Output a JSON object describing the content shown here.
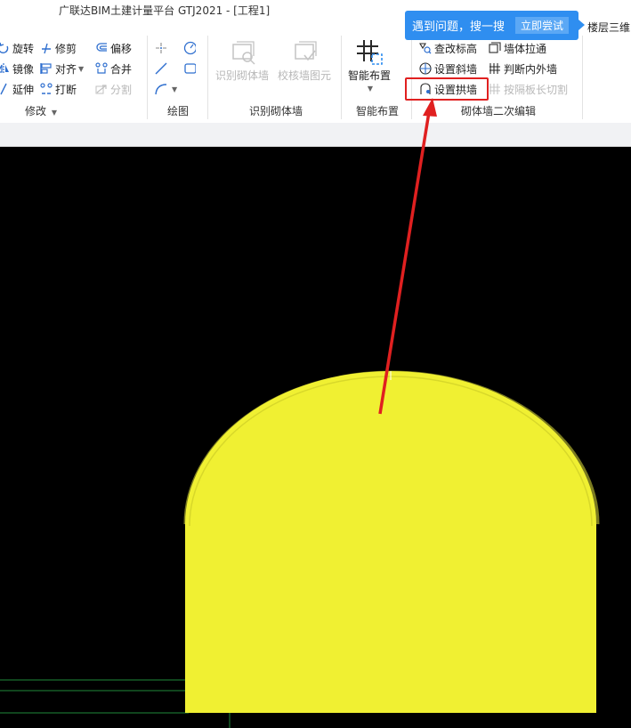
{
  "title": "广联达BIM土建计量平台 GTJ2021 - [工程1]",
  "tooltip": {
    "text": "遇到问题，搜一搜",
    "button": "立即尝试"
  },
  "side_text": "楼层三维",
  "modify": {
    "rotate": "旋转",
    "trim": "修剪",
    "offset": "偏移",
    "mirror": "镜像",
    "align": "对齐",
    "merge": "合并",
    "extend": "延伸",
    "break": "打断",
    "split": "分割",
    "group_label": "修改"
  },
  "draw": {
    "group_label": "绘图"
  },
  "recognize": {
    "identify_wall": "识别砌体墙",
    "check_wall": "校核墙图元",
    "group_label": "识别砌体墙"
  },
  "smart": {
    "smart_layout": "智能布置",
    "group_label": "智能布置"
  },
  "edit": {
    "check_elevation": "查改标高",
    "wall_stretch": "墙体拉通",
    "set_slope_wall": "设置斜墙",
    "judge_in_out": "判断内外墙",
    "set_arch_wall": "设置拱墙",
    "cut_by_slab": "按隔板长切割",
    "group_label": "砌体墙二次编辑"
  },
  "colors": {
    "accent": "#2f8ef0",
    "highlight": "#e02020",
    "wall_fill": "#f0f032",
    "canvas": "#000000"
  }
}
